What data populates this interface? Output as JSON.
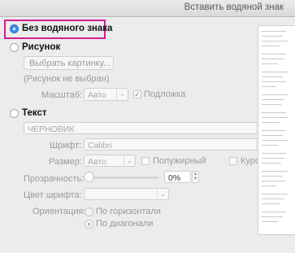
{
  "window": {
    "title": "Вставить водяной знак"
  },
  "options": {
    "none_label": "Без водяного знака",
    "picture_label": "Рисунок",
    "text_label": "Текст"
  },
  "picture": {
    "select_button": "Выбрать картинку...",
    "status": "(Рисунок не выбран)",
    "scale_label": "Масштаб:",
    "scale_value": "Авто",
    "washout_label": "Подложка"
  },
  "text": {
    "text_value": "ЧЕРНОВИК",
    "font_label": "Шрифт:",
    "font_value": "Calibri",
    "size_label": "Размер:",
    "size_value": "Авто",
    "bold_label": "Полужирный",
    "italic_label": "Курсив",
    "transparency_label": "Прозрачность:",
    "transparency_value": "0%",
    "transparency_fraction": 0,
    "color_label": "Цвет шрифта:",
    "orientation_label": "Ориентация:",
    "horizontal_label": "По горизонтали",
    "diagonal_label": "По диагонали"
  },
  "colors": {
    "highlight": "#d21f8c",
    "accent": "#3b8df4"
  }
}
